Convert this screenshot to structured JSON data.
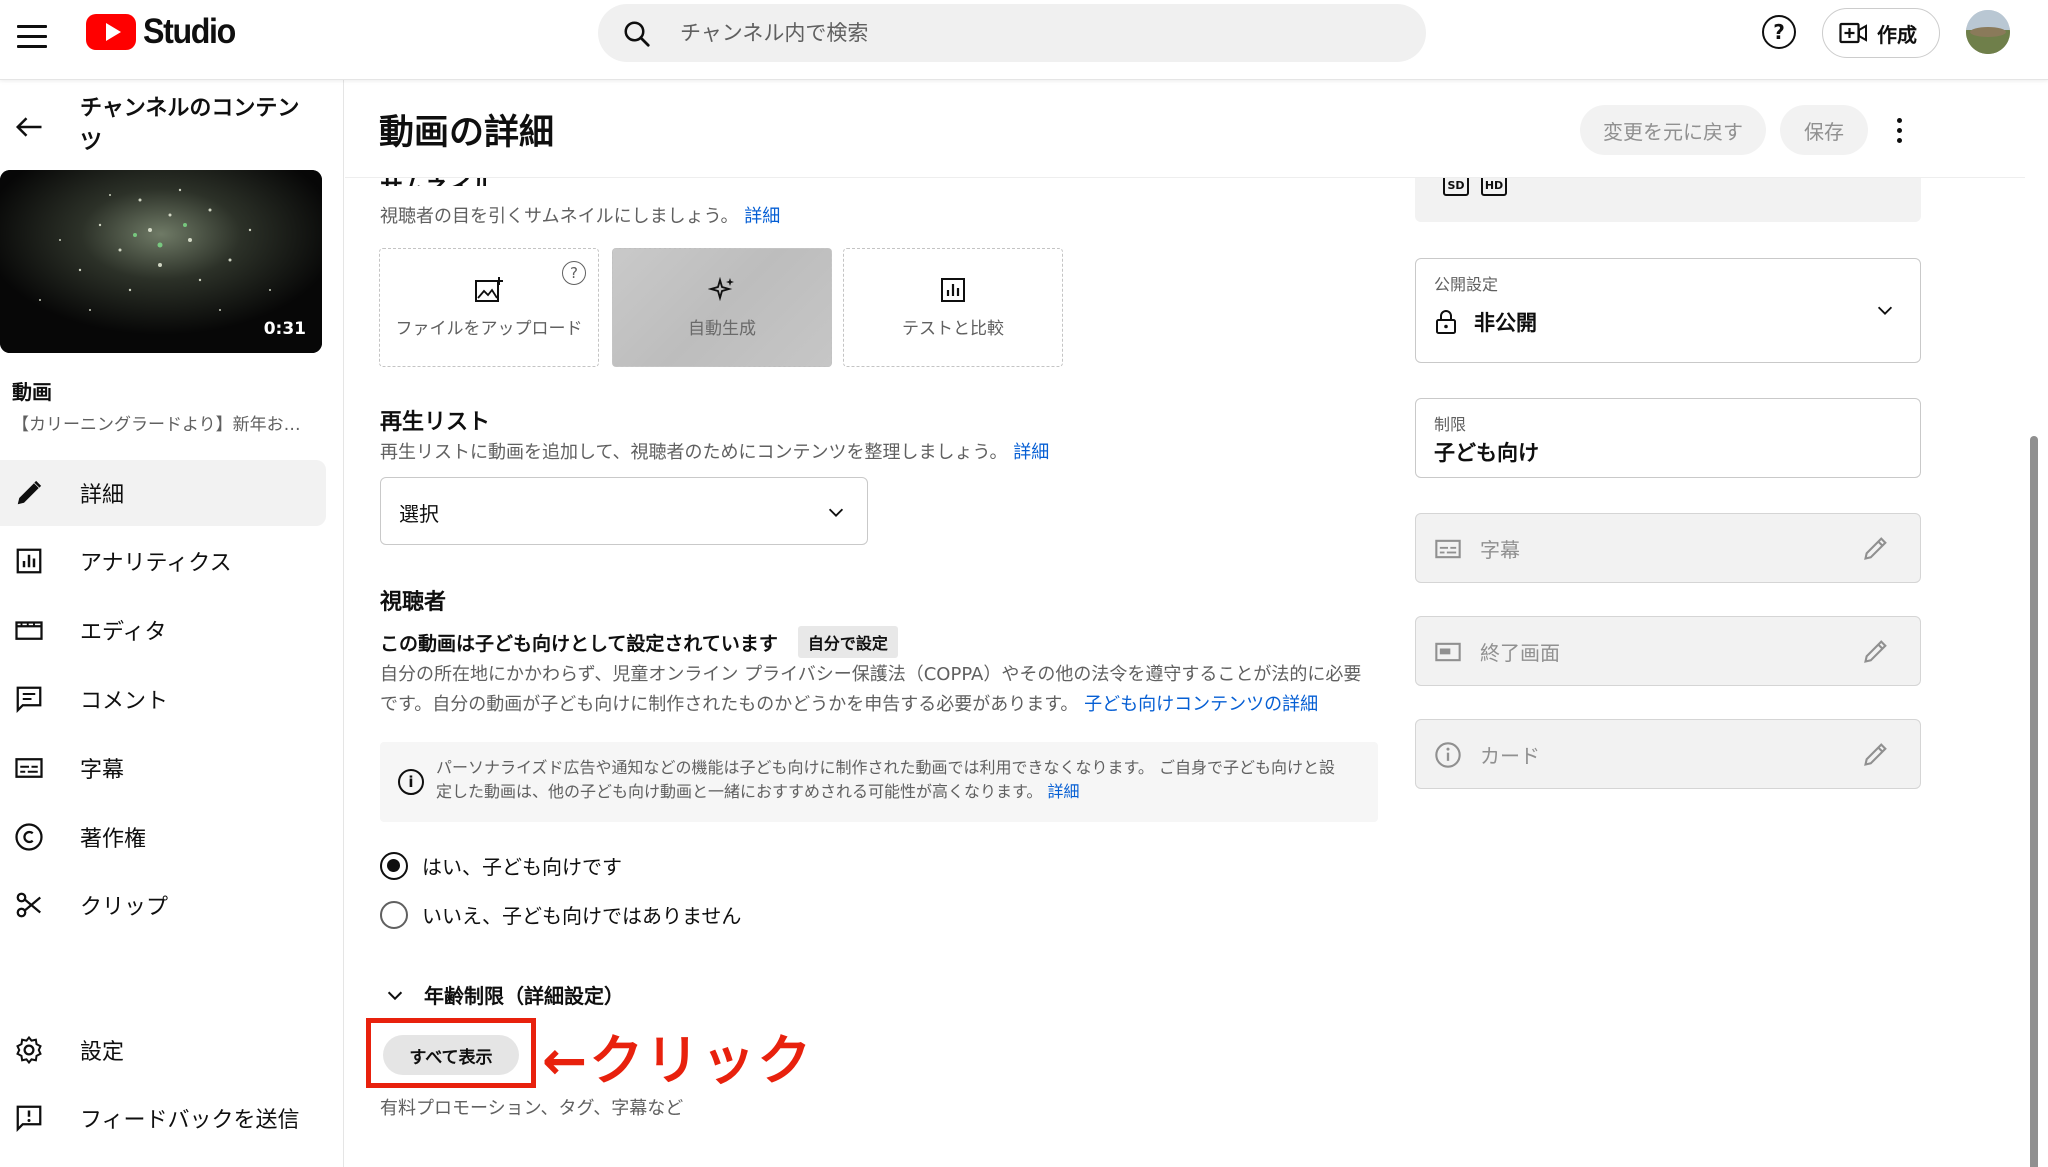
{
  "topbar": {
    "logo_text": "Studio",
    "search_placeholder": "チャンネル内で検索",
    "help_label": "?",
    "create_label": "作成"
  },
  "sidebar": {
    "title": "チャンネルのコンテンツ",
    "thumbnail_duration": "0:31",
    "video_label": "動画",
    "video_name": "【カリーニングラードより】新年お…",
    "nav": [
      {
        "label": "詳細",
        "icon": "pencil-icon",
        "active": true
      },
      {
        "label": "アナリティクス",
        "icon": "analytics-icon",
        "active": false
      },
      {
        "label": "エディタ",
        "icon": "editor-icon",
        "active": false
      },
      {
        "label": "コメント",
        "icon": "comment-icon",
        "active": false
      },
      {
        "label": "字幕",
        "icon": "subtitles-icon",
        "active": false
      },
      {
        "label": "著作権",
        "icon": "copyright-icon",
        "active": false
      },
      {
        "label": "クリップ",
        "icon": "scissors-icon",
        "active": false
      }
    ],
    "bottom_nav": [
      {
        "label": "設定",
        "icon": "gear-icon"
      },
      {
        "label": "フィードバックを送信",
        "icon": "feedback-icon"
      }
    ]
  },
  "header": {
    "title": "動画の詳細",
    "undo_label": "変更を元に戻す",
    "save_label": "保存"
  },
  "thumbnail_section": {
    "heading": "サムネイル",
    "description": "視聴者の目を引くサムネイルにしましょう。",
    "link": "詳細",
    "options": [
      {
        "label": "ファイルをアップロード",
        "icon": "image-upload-icon"
      },
      {
        "label": "自動生成",
        "icon": "sparkle-icon"
      },
      {
        "label": "テストと比較",
        "icon": "chart-icon"
      }
    ]
  },
  "playlist_section": {
    "title": "再生リスト",
    "description": "再生リストに動画を追加して、視聴者のためにコンテンツを整理しましょう。",
    "link": "詳細",
    "select_value": "選択"
  },
  "audience_section": {
    "title": "視聴者",
    "status": "この動画は子ども向けとして設定されています",
    "badge": "自分で設定",
    "paragraph": "自分の所在地にかかわらず、児童オンライン プライバシー保護法（COPPA）やその他の法令を遵守することが法的に必要です。自分の動画が子ども向けに制作されたものかどうかを申告する必要があります。",
    "paragraph_link": "子ども向けコンテンツの詳細",
    "info_text": "パーソナライズド広告や通知などの機能は子ども向けに制作された動画では利用できなくなります。 ご自身で子ども向けと設定した動画は、他の子ども向け動画と一緒におすすめされる可能性が高くなります。",
    "info_link": "詳細",
    "radio_yes": "はい、子ども向けです",
    "radio_no": "いいえ、子ども向けではありません",
    "age_restriction": "年齢制限（詳細設定）"
  },
  "show_all": {
    "button_label": "すべて表示",
    "annotation": "←クリック",
    "note": "有料プロモーション、タグ、字幕など"
  },
  "right_panel": {
    "quality_badges": [
      "SD",
      "HD"
    ],
    "visibility_label": "公開設定",
    "visibility_value": "非公開",
    "restriction_label": "制限",
    "restriction_value": "子ども向け",
    "subtitles_label": "字幕",
    "end_screen_label": "終了画面",
    "cards_label": "カード"
  },
  "colors": {
    "accent_red": "#ff0000",
    "annotation_red": "#e8210d",
    "link_blue": "#065fd4"
  }
}
